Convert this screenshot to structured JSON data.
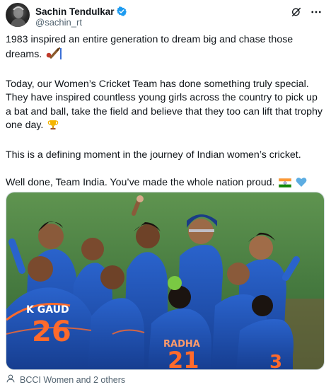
{
  "post": {
    "author_name": "Sachin Tendulkar",
    "author_handle": "@sachin_rt",
    "paragraphs": [
      "1983 inspired an entire generation to dream big and chase those dreams.",
      "Today, our Women’s Cricket Team has done something truly special. They have inspired countless young girls across the country to pick up a bat and ball, take the field and believe that they too can lift that trophy one day.",
      "This is a defining moment in the journey of Indian women’s cricket.",
      "Well done, Team India. You’ve made the whole nation proud."
    ],
    "emojis": [
      "cricket-bat-icon",
      "trophy-icon",
      "india-flag-icon",
      "blue-heart-icon"
    ]
  },
  "photo": {
    "jersey_name_left": "K GAUD",
    "jersey_number_left": "26",
    "jersey_name_center": "RADHA",
    "jersey_number_center": "21",
    "jersey_number_right": "3"
  },
  "footer": {
    "tagged_text": "BCCI Women and 2 others"
  },
  "colors": {
    "verified_blue": "#1d9bf0",
    "jersey_blue": "#1f4fb0",
    "jersey_orange": "#ff6a2b",
    "pitch_green": "#3f7a3c"
  }
}
